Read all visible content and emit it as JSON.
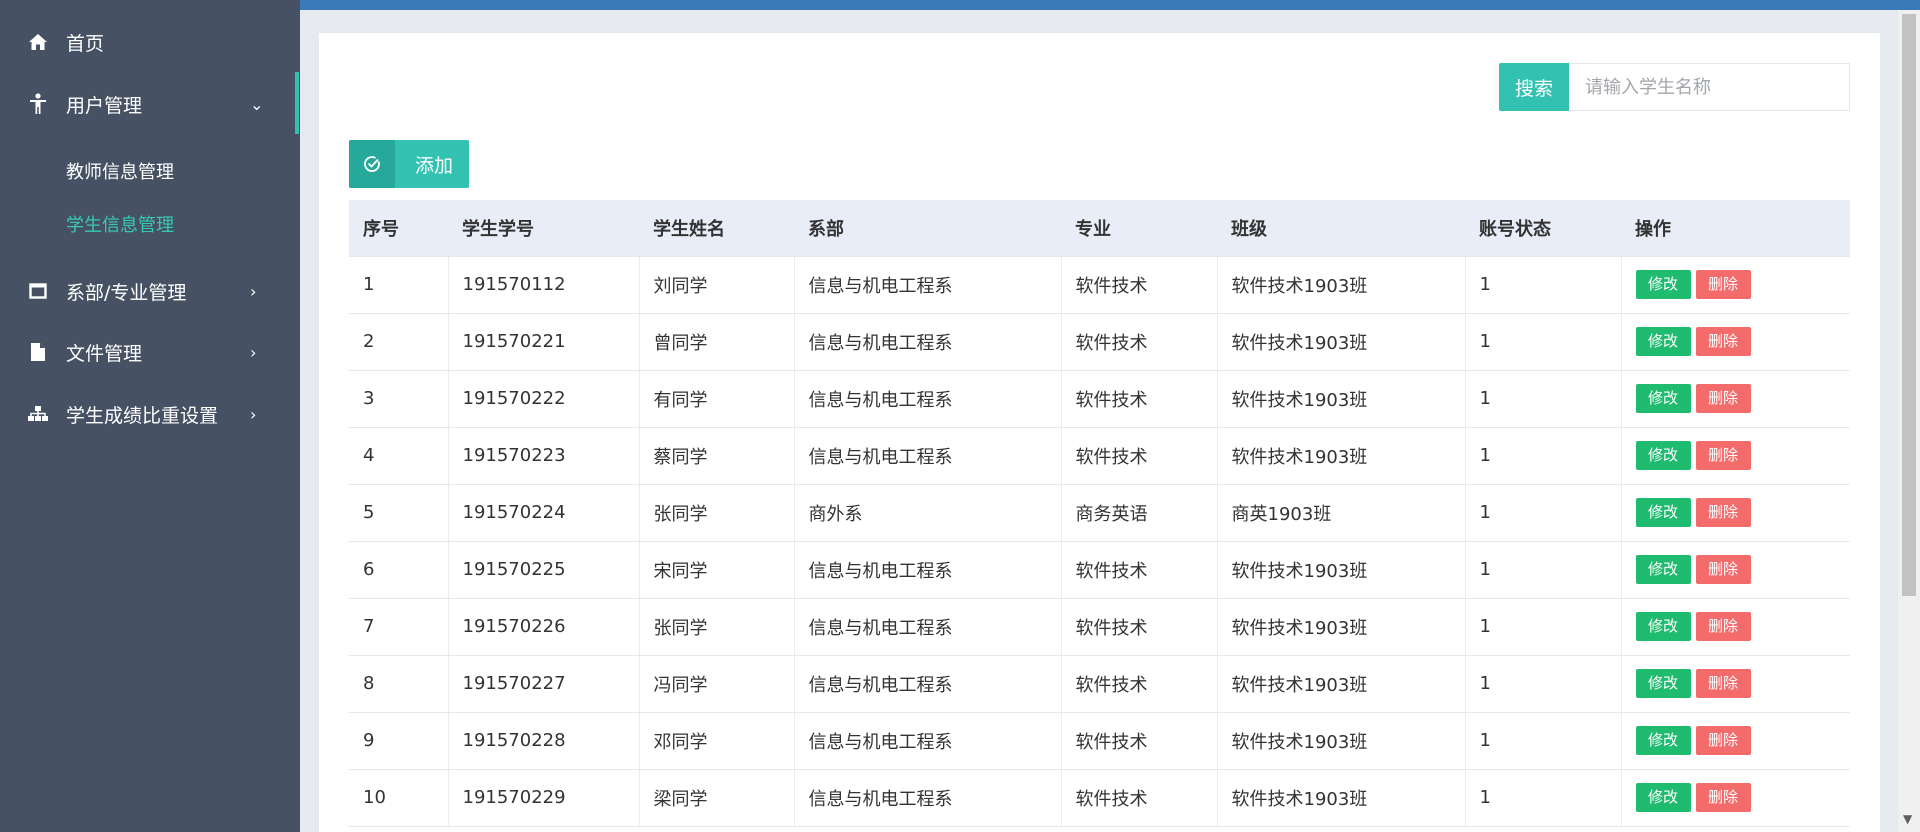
{
  "colors": {
    "accent": "#33c2b2",
    "sidebar": "#465264",
    "edit": "#1fbb6f",
    "delete": "#f36b6b",
    "topbar": "#3a7ab8"
  },
  "sidebar": {
    "items": [
      {
        "label": "首页",
        "icon": "home-icon"
      },
      {
        "label": "用户管理",
        "icon": "person-icon",
        "chevron": "⌄"
      },
      {
        "label": "系部/专业管理",
        "icon": "window-icon",
        "chevron": "›"
      },
      {
        "label": "文件管理",
        "icon": "file-icon",
        "chevron": "›"
      },
      {
        "label": "学生成绩比重设置",
        "icon": "sitemap-icon",
        "chevron": "›"
      }
    ],
    "submenu": [
      {
        "label": "教师信息管理"
      },
      {
        "label": "学生信息管理"
      }
    ]
  },
  "search": {
    "button_label": "搜索",
    "placeholder": "请输入学生名称"
  },
  "add_label": "添加",
  "table": {
    "headers": [
      "序号",
      "学生学号",
      "学生姓名",
      "系部",
      "专业",
      "班级",
      "账号状态",
      "操作"
    ],
    "edit_label": "修改",
    "delete_label": "删除",
    "rows": [
      [
        "1",
        "191570112",
        "刘同学",
        "信息与机电工程系",
        "软件技术",
        "软件技术1903班",
        "1"
      ],
      [
        "2",
        "191570221",
        "曾同学",
        "信息与机电工程系",
        "软件技术",
        "软件技术1903班",
        "1"
      ],
      [
        "3",
        "191570222",
        "有同学",
        "信息与机电工程系",
        "软件技术",
        "软件技术1903班",
        "1"
      ],
      [
        "4",
        "191570223",
        "蔡同学",
        "信息与机电工程系",
        "软件技术",
        "软件技术1903班",
        "1"
      ],
      [
        "5",
        "191570224",
        "张同学",
        "商外系",
        "商务英语",
        "商英1903班",
        "1"
      ],
      [
        "6",
        "191570225",
        "宋同学",
        "信息与机电工程系",
        "软件技术",
        "软件技术1903班",
        "1"
      ],
      [
        "7",
        "191570226",
        "张同学",
        "信息与机电工程系",
        "软件技术",
        "软件技术1903班",
        "1"
      ],
      [
        "8",
        "191570227",
        "冯同学",
        "信息与机电工程系",
        "软件技术",
        "软件技术1903班",
        "1"
      ],
      [
        "9",
        "191570228",
        "邓同学",
        "信息与机电工程系",
        "软件技术",
        "软件技术1903班",
        "1"
      ],
      [
        "10",
        "191570229",
        "梁同学",
        "信息与机电工程系",
        "软件技术",
        "软件技术1903班",
        "1"
      ]
    ]
  }
}
